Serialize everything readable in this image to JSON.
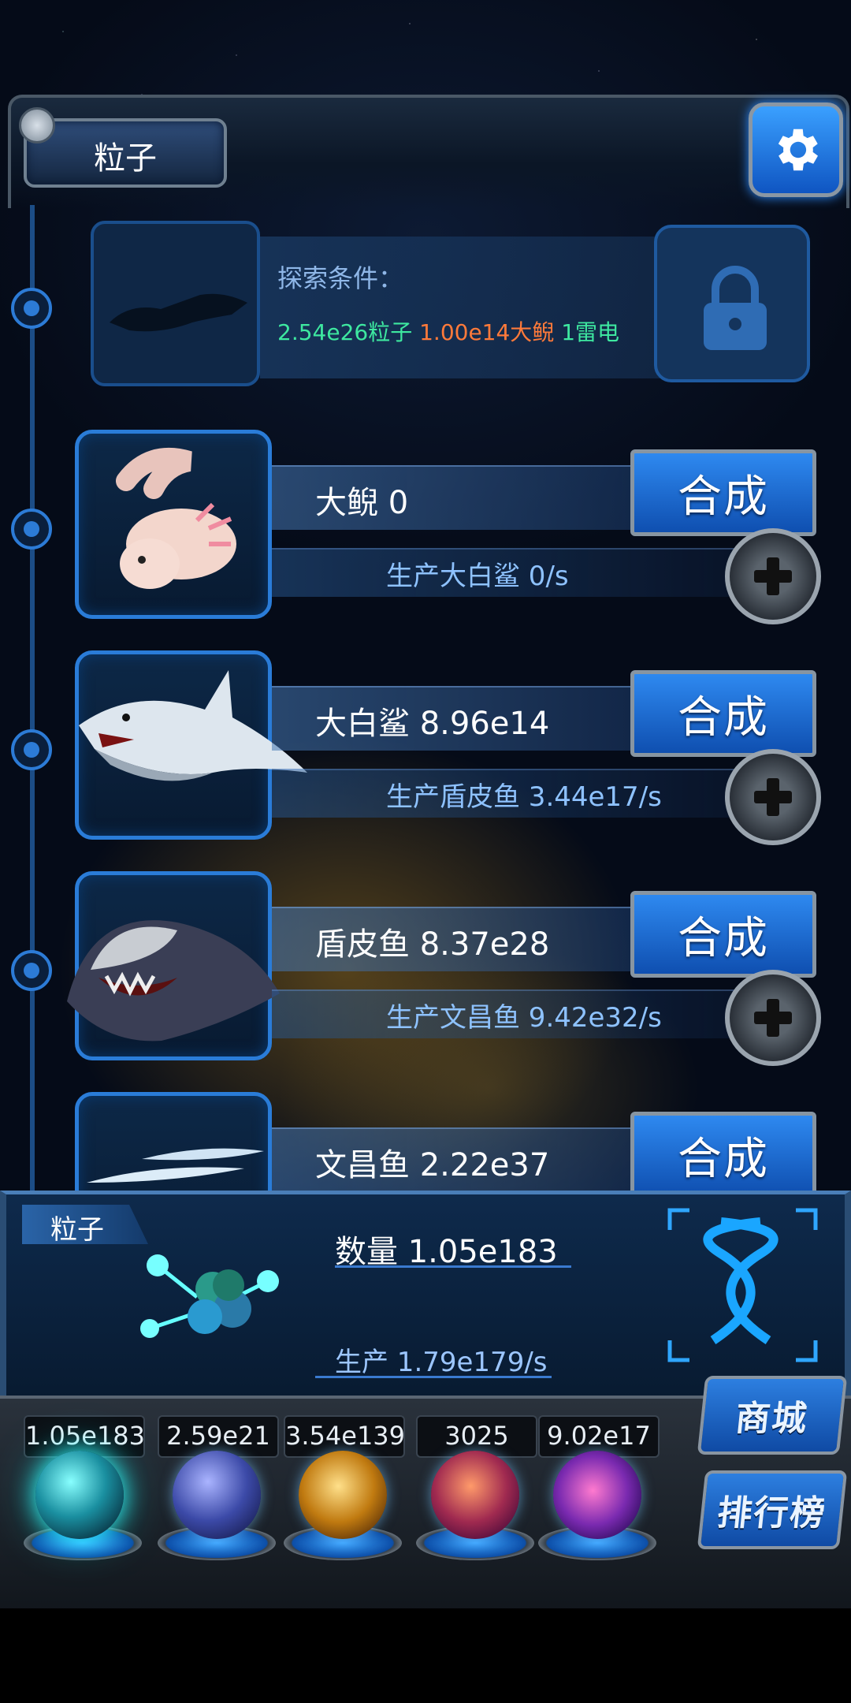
{
  "header": {
    "title": "粒子",
    "settings_icon": "gear-icon"
  },
  "locked": {
    "condition_title": "探索条件：",
    "req1": "2.54e26粒子",
    "req2": "1.00e14大鲵",
    "req3": "1雷电",
    "colors": {
      "req1": "#3ee8a0",
      "req2": "#ff7a3a",
      "req3": "#3ee8a0"
    }
  },
  "creatures": [
    {
      "name": "大鲵 0",
      "production": "生产大白鲨 0/s",
      "button": "合成",
      "icon": "axolotl-icon"
    },
    {
      "name": "大白鲨 8.96e14",
      "production": "生产盾皮鱼 3.44e17/s",
      "button": "合成",
      "icon": "shark-icon"
    },
    {
      "name": "盾皮鱼 8.37e28",
      "production": "生产文昌鱼 9.42e32/s",
      "button": "合成",
      "icon": "armored-fish-icon"
    },
    {
      "name": "文昌鱼 2.22e37",
      "production": "",
      "button": "合成",
      "icon": "lancelet-icon"
    }
  ],
  "particle_panel": {
    "tag": "粒子",
    "count": "数量 1.05e183",
    "production": "生产 1.79e179/s"
  },
  "resources": [
    {
      "value": "1.05e183",
      "icon": "particle-orb-icon"
    },
    {
      "value": "2.59e21",
      "icon": "lightning-orb-icon"
    },
    {
      "value": "3.54e139",
      "icon": "fire-orb-icon"
    },
    {
      "value": "3025",
      "icon": "brain-orb-icon"
    },
    {
      "value": "9.02e17",
      "icon": "vortex-orb-icon"
    }
  ],
  "side_buttons": {
    "shop": "商城",
    "ranking": "排行榜"
  }
}
